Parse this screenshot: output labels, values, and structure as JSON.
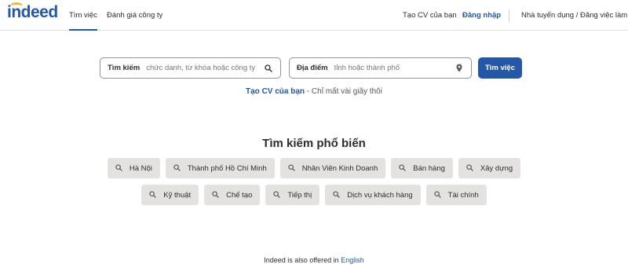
{
  "header": {
    "logo_text": "indeed",
    "nav": {
      "find_jobs": "Tìm việc",
      "company_reviews": "Đánh giá công ty",
      "create_cv": "Tạo CV của bạn",
      "sign_in": "Đăng nhập",
      "employers": "Nhà tuyển dụng / Đăng việc làm"
    }
  },
  "search": {
    "what_label": "Tìm kiếm",
    "what_placeholder": "chức danh, từ khóa hoặc công ty",
    "where_label": "Địa điểm",
    "where_placeholder": "tỉnh hoặc thành phố",
    "button_label": "Tìm việc"
  },
  "cv_prompt": {
    "link": "Tạo CV của bạn",
    "separator": " - ",
    "rest": "Chỉ mất vài giây thôi"
  },
  "popular": {
    "title": "Tìm kiếm phổ biến",
    "row1": [
      "Hà Nội",
      "Thành phố Hồ Chí Minh",
      "Nhân Viên Kinh Doanh",
      "Bán hàng",
      "Xây dựng"
    ],
    "row2": [
      "Kỹ thuật",
      "Chế tạo",
      "Tiếp thị",
      "Dịch vụ khách hàng",
      "Tài chính"
    ]
  },
  "footer": {
    "text": "Indeed is also offered in",
    "language_link": "English"
  },
  "colors": {
    "brand_blue": "#2557a7",
    "logo_accent": "#e8b83b",
    "chip_bg": "#e4e2e0"
  },
  "icons": {
    "search": "search-icon",
    "location": "location-pin-icon"
  }
}
